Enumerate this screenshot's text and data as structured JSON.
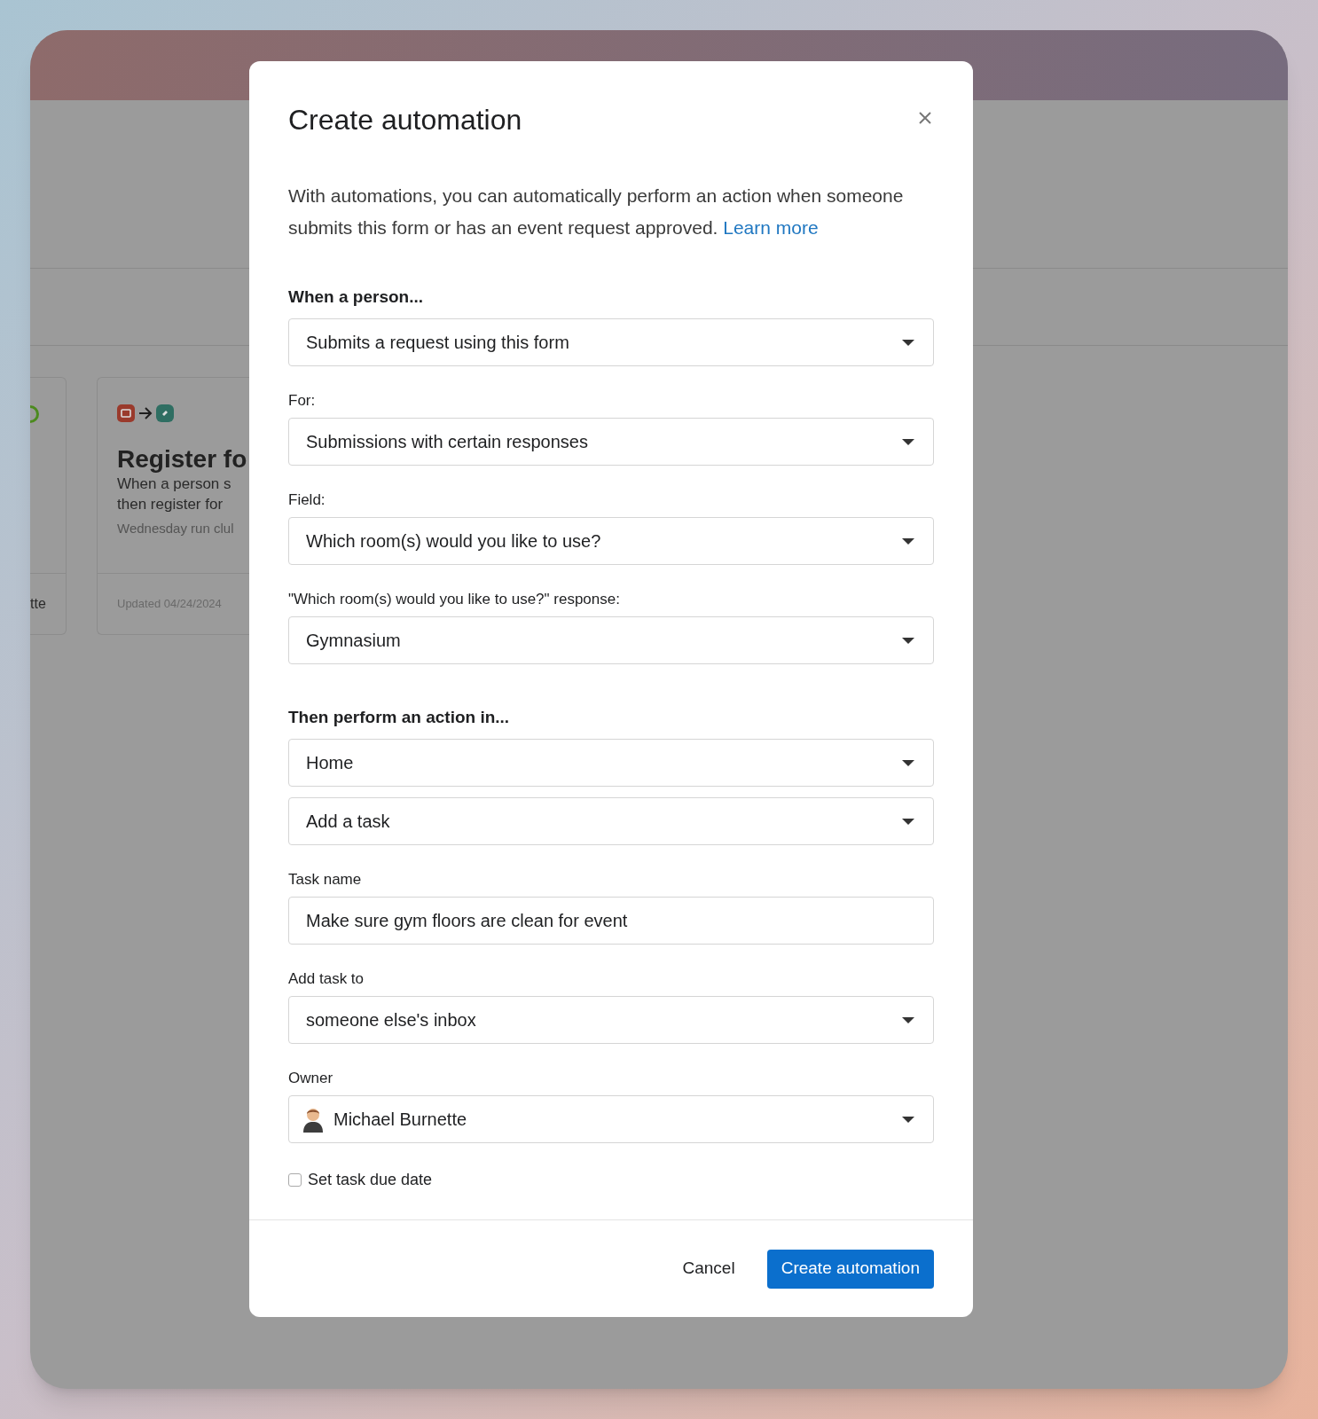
{
  "background": {
    "left_card": {
      "footer": "tte"
    },
    "card": {
      "title": "Register fo",
      "description_lines": [
        "When a person s",
        "then register for"
      ],
      "subtitle": "Wednesday run clul",
      "footer": "Updated 04/24/2024"
    }
  },
  "dialog": {
    "title": "Create automation",
    "description": "With automations, you can automatically perform an action when someone submits this form or has an event request approved.",
    "link": "Learn more",
    "items": [
      {
        "kind": "heading",
        "text": "When a person..."
      },
      {
        "kind": "select",
        "value": "Submits a request using this form"
      },
      {
        "kind": "label",
        "text": "For:"
      },
      {
        "kind": "select",
        "value": "Submissions with certain responses"
      },
      {
        "kind": "label",
        "text": "Field:"
      },
      {
        "kind": "select",
        "value": "Which room(s) would you like to use?"
      },
      {
        "kind": "label",
        "text": "\"Which room(s) would you like to use?\" response:"
      },
      {
        "kind": "select",
        "value": "Gymnasium"
      },
      {
        "kind": "heading",
        "text": "Then perform an action in..."
      },
      {
        "kind": "select",
        "value": "Home"
      },
      {
        "kind": "select",
        "value": "Add a task"
      },
      {
        "kind": "label",
        "text": "Task name"
      },
      {
        "kind": "text",
        "value": "Make sure gym floors are clean for event"
      },
      {
        "kind": "label",
        "text": "Add task to"
      },
      {
        "kind": "select",
        "value": "someone else's inbox"
      },
      {
        "kind": "label",
        "text": "Owner"
      },
      {
        "kind": "person",
        "value": "Michael Burnette"
      },
      {
        "kind": "checkbox",
        "text": "Set task due date",
        "checked": false
      }
    ],
    "buttons": [
      {
        "label": "Cancel",
        "primary": false
      },
      {
        "label": "Create automation",
        "primary": true
      }
    ]
  }
}
